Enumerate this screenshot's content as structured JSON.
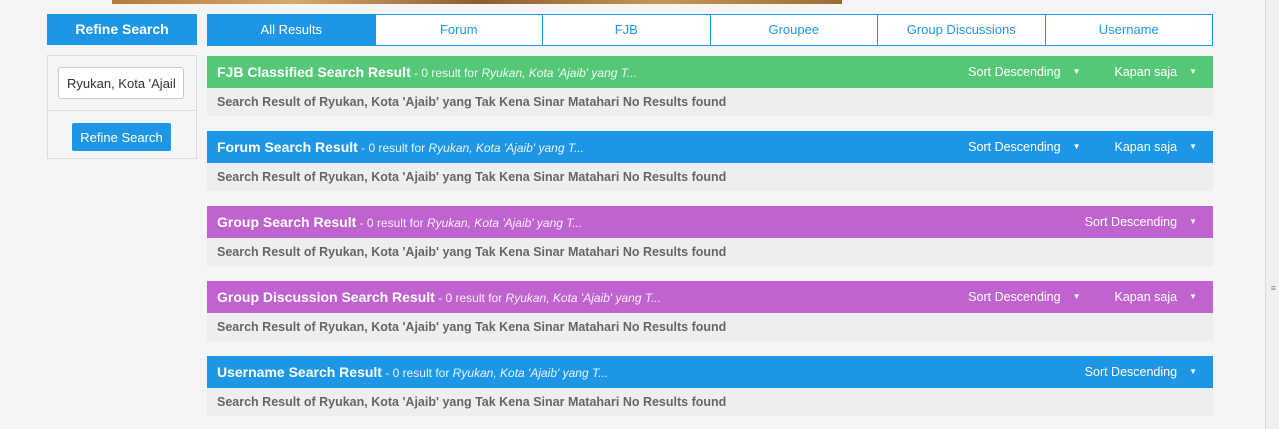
{
  "sidebar": {
    "refine_title": "Refine Search",
    "input_value": "Ryukan, Kota 'Ajaib' yang Tak Kena Sinar Matahari",
    "button_label": "Refine Search"
  },
  "tabs": [
    {
      "label": "All Results",
      "active": true
    },
    {
      "label": "Forum",
      "active": false
    },
    {
      "label": "FJB",
      "active": false
    },
    {
      "label": "Groupee",
      "active": false
    },
    {
      "label": "Group Discussions",
      "active": false
    },
    {
      "label": "Username",
      "active": false
    }
  ],
  "sections": {
    "fjb": {
      "title": "FJB Classified Search Result",
      "meta": " - 0 result for ",
      "query": "Ryukan, Kota 'Ajaib' yang T...",
      "sort_label": "Sort Descending",
      "time_label": "Kapan saja",
      "body": "Search Result of Ryukan, Kota 'Ajaib' yang Tak Kena Sinar Matahari No Results found",
      "color": "#55c878"
    },
    "forum": {
      "title": "Forum Search Result",
      "meta": " - 0 result for ",
      "query": "Ryukan, Kota 'Ajaib' yang T...",
      "sort_label": "Sort Descending",
      "time_label": "Kapan saja",
      "body": "Search Result of Ryukan, Kota 'Ajaib' yang Tak Kena Sinar Matahari No Results found",
      "color": "#1e96e6"
    },
    "group": {
      "title": "Group Search Result",
      "meta": " - 0 result for ",
      "query": "Ryukan, Kota 'Ajaib' yang T...",
      "sort_label": "Sort Descending",
      "body": "Search Result of Ryukan, Kota 'Ajaib' yang Tak Kena Sinar Matahari No Results found",
      "color": "#c062cf"
    },
    "group_discussion": {
      "title": "Group Discussion Search Result",
      "meta": " - 0 result for ",
      "query": "Ryukan, Kota 'Ajaib' yang T...",
      "sort_label": "Sort Descending",
      "time_label": "Kapan saja",
      "body": "Search Result of Ryukan, Kota 'Ajaib' yang Tak Kena Sinar Matahari No Results found",
      "color": "#c062cf"
    },
    "username": {
      "title": "Username Search Result",
      "meta": " - 0 result for ",
      "query": "Ryukan, Kota 'Ajaib' yang T...",
      "sort_label": "Sort Descending",
      "body": "Search Result of Ryukan, Kota 'Ajaib' yang Tak Kena Sinar Matahari No Results found",
      "color": "#1e96e6"
    }
  },
  "icons": {
    "caret": "caret-down-icon"
  }
}
